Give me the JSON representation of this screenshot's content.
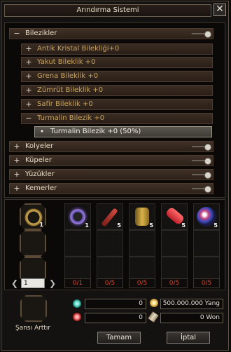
{
  "window": {
    "title": "Arındırma Sistemi",
    "close_glyph": "✕"
  },
  "tree": {
    "category_main": {
      "label": "Bilezikler",
      "toggle": "−"
    },
    "subitems": [
      {
        "label": "Antik Kristal Bilekliği+0",
        "toggle": "+"
      },
      {
        "label": "Yakut Bileklik +0",
        "toggle": "+"
      },
      {
        "label": "Grena Bileklik +0",
        "toggle": "+"
      },
      {
        "label": "Zümrüt Bileklik +0",
        "toggle": "+"
      },
      {
        "label": "Safir Bileklik +0",
        "toggle": "+"
      },
      {
        "label": "Turmalin Bilezik +0",
        "toggle": "−"
      }
    ],
    "selected": {
      "label": "Turmalin Bilezik +0 (50%)",
      "bullet": "•"
    },
    "categories": [
      {
        "label": "Kolyeler",
        "toggle": "+"
      },
      {
        "label": "Küpeler",
        "toggle": "+"
      },
      {
        "label": "Yüzükler",
        "toggle": "+"
      },
      {
        "label": "Kemerler",
        "toggle": "+"
      }
    ]
  },
  "materials": {
    "main_slot": {
      "icon": "bracelet-icon",
      "count": "1"
    },
    "slots": [
      {
        "icon": "beaded-bracelet-icon",
        "count": "1",
        "ratio": "0/1"
      },
      {
        "icon": "red-wand-icon",
        "count": "5",
        "ratio": "0/5"
      },
      {
        "icon": "gold-cylinder-icon",
        "count": "5",
        "ratio": "0/5"
      },
      {
        "icon": "red-scroll-icon",
        "count": "5",
        "ratio": "0/5"
      },
      {
        "icon": "crystal-orb-icon",
        "count": "5",
        "ratio": "0/5"
      }
    ]
  },
  "pager": {
    "page": "1",
    "prev": "❮",
    "next": "❯"
  },
  "bottom": {
    "chance_label": "Şansı Arttır",
    "field_teal": "0",
    "field_red": "0",
    "yang": "500.000.000 Yang",
    "won": "0 Won",
    "ok_label": "Tamam",
    "cancel_label": "İptal"
  },
  "colors": {
    "accent_red": "#d6432b",
    "gold_text": "#c9a35e",
    "panel_bg": "#0a0908"
  }
}
